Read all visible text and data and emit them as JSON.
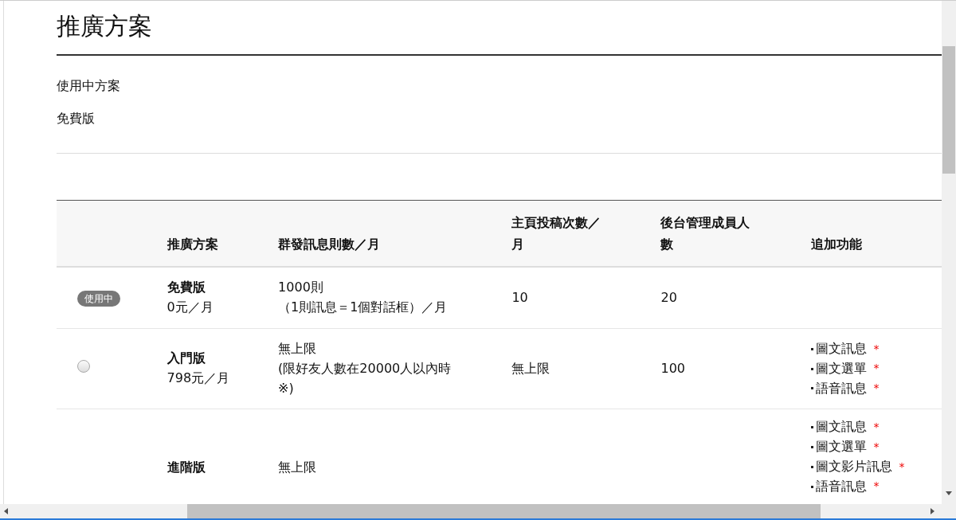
{
  "page": {
    "title": "推廣方案",
    "current_plan_label": "使用中方案",
    "current_plan": "免費版"
  },
  "table": {
    "columns": [
      "推廣方案",
      "群發訊息則數／月",
      "主頁投稿次數／月",
      "後台管理成員人數",
      "追加功能"
    ],
    "rows": [
      {
        "selected": true,
        "badge": "使用中",
        "plan": "免費版",
        "price": "0元／月",
        "messages": [
          "1000則",
          "（1則訊息＝1個對話框）／月"
        ],
        "posts": "10",
        "admins": "20",
        "features": []
      },
      {
        "selected": false,
        "plan": "入門版",
        "price": "798元／月",
        "messages": [
          "無上限",
          "(限好友人數在20000人以內時※)"
        ],
        "posts": "無上限",
        "admins": "100",
        "features": [
          {
            "text": "圖文訊息",
            "mark": "*"
          },
          {
            "text": "圖文選單",
            "mark": "*"
          },
          {
            "text": "語音訊息",
            "mark": "*"
          }
        ]
      },
      {
        "plan": "進階版",
        "messages": [
          "無上限"
        ],
        "features": [
          {
            "text": "圖文訊息",
            "mark": "*"
          },
          {
            "text": "圖文選單",
            "mark": "*"
          },
          {
            "text": "圖文影片訊息",
            "mark": "*"
          },
          {
            "text": "語音訊息",
            "mark": "*"
          }
        ]
      }
    ]
  }
}
